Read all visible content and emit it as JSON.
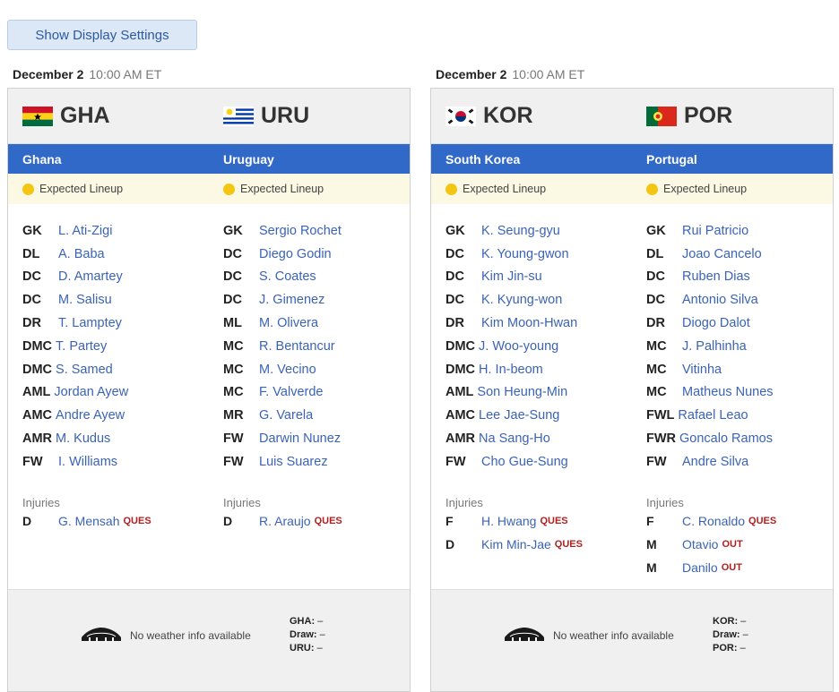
{
  "settings_button": "Show Display Settings",
  "games": [
    {
      "date": "December 2",
      "time": "10:00 AM ET",
      "home": {
        "abbr": "GHA",
        "name": "Ghana"
      },
      "away": {
        "abbr": "URU",
        "name": "Uruguay"
      },
      "expected_label": "Expected Lineup",
      "home_lineup": [
        {
          "pos": "GK",
          "player": "L. Ati-Zigi"
        },
        {
          "pos": "DL",
          "player": "A. Baba"
        },
        {
          "pos": "DC",
          "player": "D. Amartey"
        },
        {
          "pos": "DC",
          "player": "M. Salisu"
        },
        {
          "pos": "DR",
          "player": "T. Lamptey"
        },
        {
          "pos": "DMC",
          "player": "T. Partey"
        },
        {
          "pos": "DMC",
          "player": "S. Samed"
        },
        {
          "pos": "AML",
          "player": "Jordan Ayew"
        },
        {
          "pos": "AMC",
          "player": "Andre Ayew"
        },
        {
          "pos": "AMR",
          "player": "M. Kudus"
        },
        {
          "pos": "FW",
          "player": "I. Williams"
        }
      ],
      "away_lineup": [
        {
          "pos": "GK",
          "player": "Sergio Rochet"
        },
        {
          "pos": "DC",
          "player": "Diego Godin"
        },
        {
          "pos": "DC",
          "player": "S. Coates"
        },
        {
          "pos": "DC",
          "player": "J. Gimenez"
        },
        {
          "pos": "ML",
          "player": "M. Olivera"
        },
        {
          "pos": "MC",
          "player": "R. Bentancur"
        },
        {
          "pos": "MC",
          "player": "M. Vecino"
        },
        {
          "pos": "MC",
          "player": "F. Valverde"
        },
        {
          "pos": "MR",
          "player": "G. Varela"
        },
        {
          "pos": "FW",
          "player": "Darwin Nunez"
        },
        {
          "pos": "FW",
          "player": "Luis Suarez"
        }
      ],
      "injuries_label": "Injuries",
      "home_injuries": [
        {
          "pos": "D",
          "player": "G. Mensah",
          "status": "QUES"
        }
      ],
      "away_injuries": [
        {
          "pos": "D",
          "player": "R. Araujo",
          "status": "QUES"
        }
      ],
      "weather": "No weather info available",
      "odds": [
        {
          "label": "GHA:",
          "value": "–"
        },
        {
          "label": "Draw:",
          "value": "–"
        },
        {
          "label": "URU:",
          "value": "–"
        }
      ]
    },
    {
      "date": "December 2",
      "time": "10:00 AM ET",
      "home": {
        "abbr": "KOR",
        "name": "South Korea"
      },
      "away": {
        "abbr": "POR",
        "name": "Portugal"
      },
      "expected_label": "Expected Lineup",
      "home_lineup": [
        {
          "pos": "GK",
          "player": "K. Seung-gyu"
        },
        {
          "pos": "DC",
          "player": "K. Young-gwon"
        },
        {
          "pos": "DC",
          "player": "Kim Jin-su"
        },
        {
          "pos": "DC",
          "player": "K. Kyung-won"
        },
        {
          "pos": "DR",
          "player": "Kim Moon-Hwan"
        },
        {
          "pos": "DMC",
          "player": "J. Woo-young"
        },
        {
          "pos": "DMC",
          "player": "H. In-beom"
        },
        {
          "pos": "AML",
          "player": "Son Heung-Min"
        },
        {
          "pos": "AMC",
          "player": "Lee Jae-Sung"
        },
        {
          "pos": "AMR",
          "player": "Na Sang-Ho"
        },
        {
          "pos": "FW",
          "player": "Cho Gue-Sung"
        }
      ],
      "away_lineup": [
        {
          "pos": "GK",
          "player": "Rui Patricio"
        },
        {
          "pos": "DL",
          "player": "Joao Cancelo"
        },
        {
          "pos": "DC",
          "player": "Ruben Dias"
        },
        {
          "pos": "DC",
          "player": "Antonio Silva"
        },
        {
          "pos": "DR",
          "player": "Diogo Dalot"
        },
        {
          "pos": "MC",
          "player": "J. Palhinha"
        },
        {
          "pos": "MC",
          "player": "Vitinha"
        },
        {
          "pos": "MC",
          "player": "Matheus Nunes"
        },
        {
          "pos": "FWL",
          "player": "Rafael Leao"
        },
        {
          "pos": "FWR",
          "player": "Goncalo Ramos"
        },
        {
          "pos": "FW",
          "player": "Andre Silva"
        }
      ],
      "injuries_label": "Injuries",
      "home_injuries": [
        {
          "pos": "F",
          "player": "H. Hwang",
          "status": "QUES"
        },
        {
          "pos": "D",
          "player": "Kim Min-Jae",
          "status": "QUES"
        }
      ],
      "away_injuries": [
        {
          "pos": "F",
          "player": "C. Ronaldo",
          "status": "QUES"
        },
        {
          "pos": "M",
          "player": "Otavio",
          "status": "OUT"
        },
        {
          "pos": "M",
          "player": "Danilo",
          "status": "OUT"
        }
      ],
      "weather": "No weather info available",
      "odds": [
        {
          "label": "KOR:",
          "value": "–"
        },
        {
          "label": "Draw:",
          "value": "–"
        },
        {
          "label": "POR:",
          "value": "–"
        }
      ]
    }
  ],
  "colors": {
    "team_bar": "#3069c8",
    "player_link": "#3b63b5",
    "status_tag": "#b21f1f",
    "expected_bg": "#fbf8e4",
    "expected_dot": "#f3c614"
  }
}
